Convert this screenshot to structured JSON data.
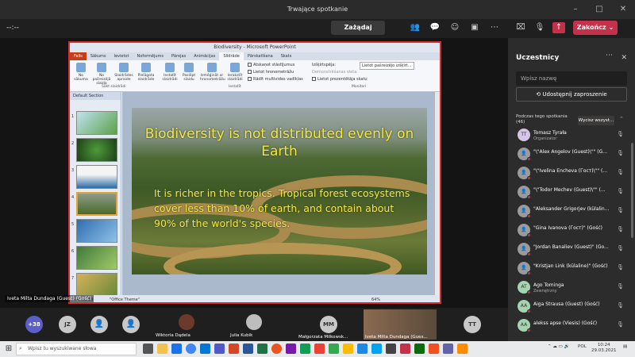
{
  "window": {
    "title": "Trwające spotkanie"
  },
  "toolbar": {
    "timer": "--:--",
    "take_control_label": "Zażądaj kontroli",
    "end_label": "Zakończ",
    "icons": [
      "participants-icon",
      "chat-icon",
      "reactions-icon",
      "breakout-icon",
      "more-icon",
      "camera-off-icon",
      "mic-off-icon",
      "share-icon"
    ]
  },
  "powerpoint": {
    "title": "Biodiversity - Microsoft PowerPoint",
    "tabs": [
      "Fails",
      "Sākums",
      "Ievietot",
      "Noformējums",
      "Pārejas",
      "Animācijas",
      "Slīdrāde",
      "Pārskatīšana",
      "Skats"
    ],
    "active_tab": "Slīdrāde",
    "ribbon_buttons": [
      "No sākuma",
      "No pašreizējā slaida",
      "Slaidrādes apraide",
      "Pielāgota slaidrāde",
      "Iestatīt slaidrādi",
      "Paslēpt slaidu",
      "Izmēģināt ar hronometrāžu",
      "Ierakstīt slaidrādi"
    ],
    "ribbon_checks": [
      "Atskaņot stāstījumus",
      "Lietot hronometrāžu",
      "Rādīt multivides vadīklas"
    ],
    "ribbon_monitor": [
      "Izšķirtspēja:",
      "Lietot pašreizējo izšķirt...",
      "Demonstrēšanas vieta:",
      "Lietot prezentētāja skatu"
    ],
    "ribbon_groups": [
      "Sākt slaidrādi",
      "Iestatīt",
      "Monitori"
    ],
    "section": "Default Section",
    "thumb_numbers": [
      "1",
      "2",
      "3",
      "4",
      "5",
      "6",
      "7"
    ],
    "status": "...4. no 13",
    "theme": "\"Office Theme\"",
    "zoom": "64%"
  },
  "slide": {
    "title": "Biodiversity is not distributed evenly on Earth",
    "body": "It is richer in the tropics. Tropical forest ecosystems cover less than 10% of earth, and contain about 90% of the world's species."
  },
  "presenter_label": "Iveta Milta Dundaga (Guest) (Gość)",
  "panel": {
    "title": "Uczestnicy",
    "search_placeholder": "Wpisz nazwę",
    "share_invite": "Udostępnij zaproszenie",
    "during_meeting": "Podczas tego spotkania",
    "count": "(46)",
    "mute_all": "Wycisz wszyst...",
    "participants": [
      {
        "initials": "TT",
        "name": "Tomasz Tyrała",
        "role": "Organizator"
      },
      {
        "initials": "",
        "name": "\"\\\"Alex Angelov (Guest)\\\"\" (G...",
        "role": ""
      },
      {
        "initials": "",
        "name": "\"\\\"Ivelina Encheva (Гост)\\\"\" (...",
        "role": ""
      },
      {
        "initials": "",
        "name": "\"\\\"Todor Mechev (Guest)\\\"\" (...",
        "role": ""
      },
      {
        "initials": "",
        "name": "\"Aleksander Grigorjev (külalin...",
        "role": ""
      },
      {
        "initials": "",
        "name": "\"Gina Ivanova (Гост)\" (Gość)",
        "role": ""
      },
      {
        "initials": "",
        "name": "\"Jordan Banaliev (Guest)\" (Go...",
        "role": ""
      },
      {
        "initials": "",
        "name": "\"Kristjan Link (külaline)\" (Gość)",
        "role": ""
      },
      {
        "initials": "AT",
        "name": "Ago Tominga",
        "role": "Zewnętrzny"
      },
      {
        "initials": "AA",
        "name": "Aiga Štrausa (Guest) (Gość)",
        "role": ""
      },
      {
        "initials": "AA",
        "name": "alekss apse (Viesis) (Gość)",
        "role": ""
      }
    ]
  },
  "bottom_tiles": {
    "more_count": "+38",
    "jz": "JZ",
    "wiktoria": "Wiktoria Dądela",
    "julia": "Julia Kubik",
    "mm": "MM",
    "malgorzata": "Małgorzata Milkowsk...",
    "iveta": "Iveta Milta Dundaga (Gues...",
    "tt": "TT"
  },
  "taskbar": {
    "search_placeholder": "Wpisz tu wyszukiwane słowa",
    "lang": "POL",
    "time": "10:24",
    "date": "29.03.2021"
  },
  "colors": {
    "accent_end": "#c4314b",
    "slide_text": "#f3e93a",
    "share_border": "#d32f2f"
  }
}
